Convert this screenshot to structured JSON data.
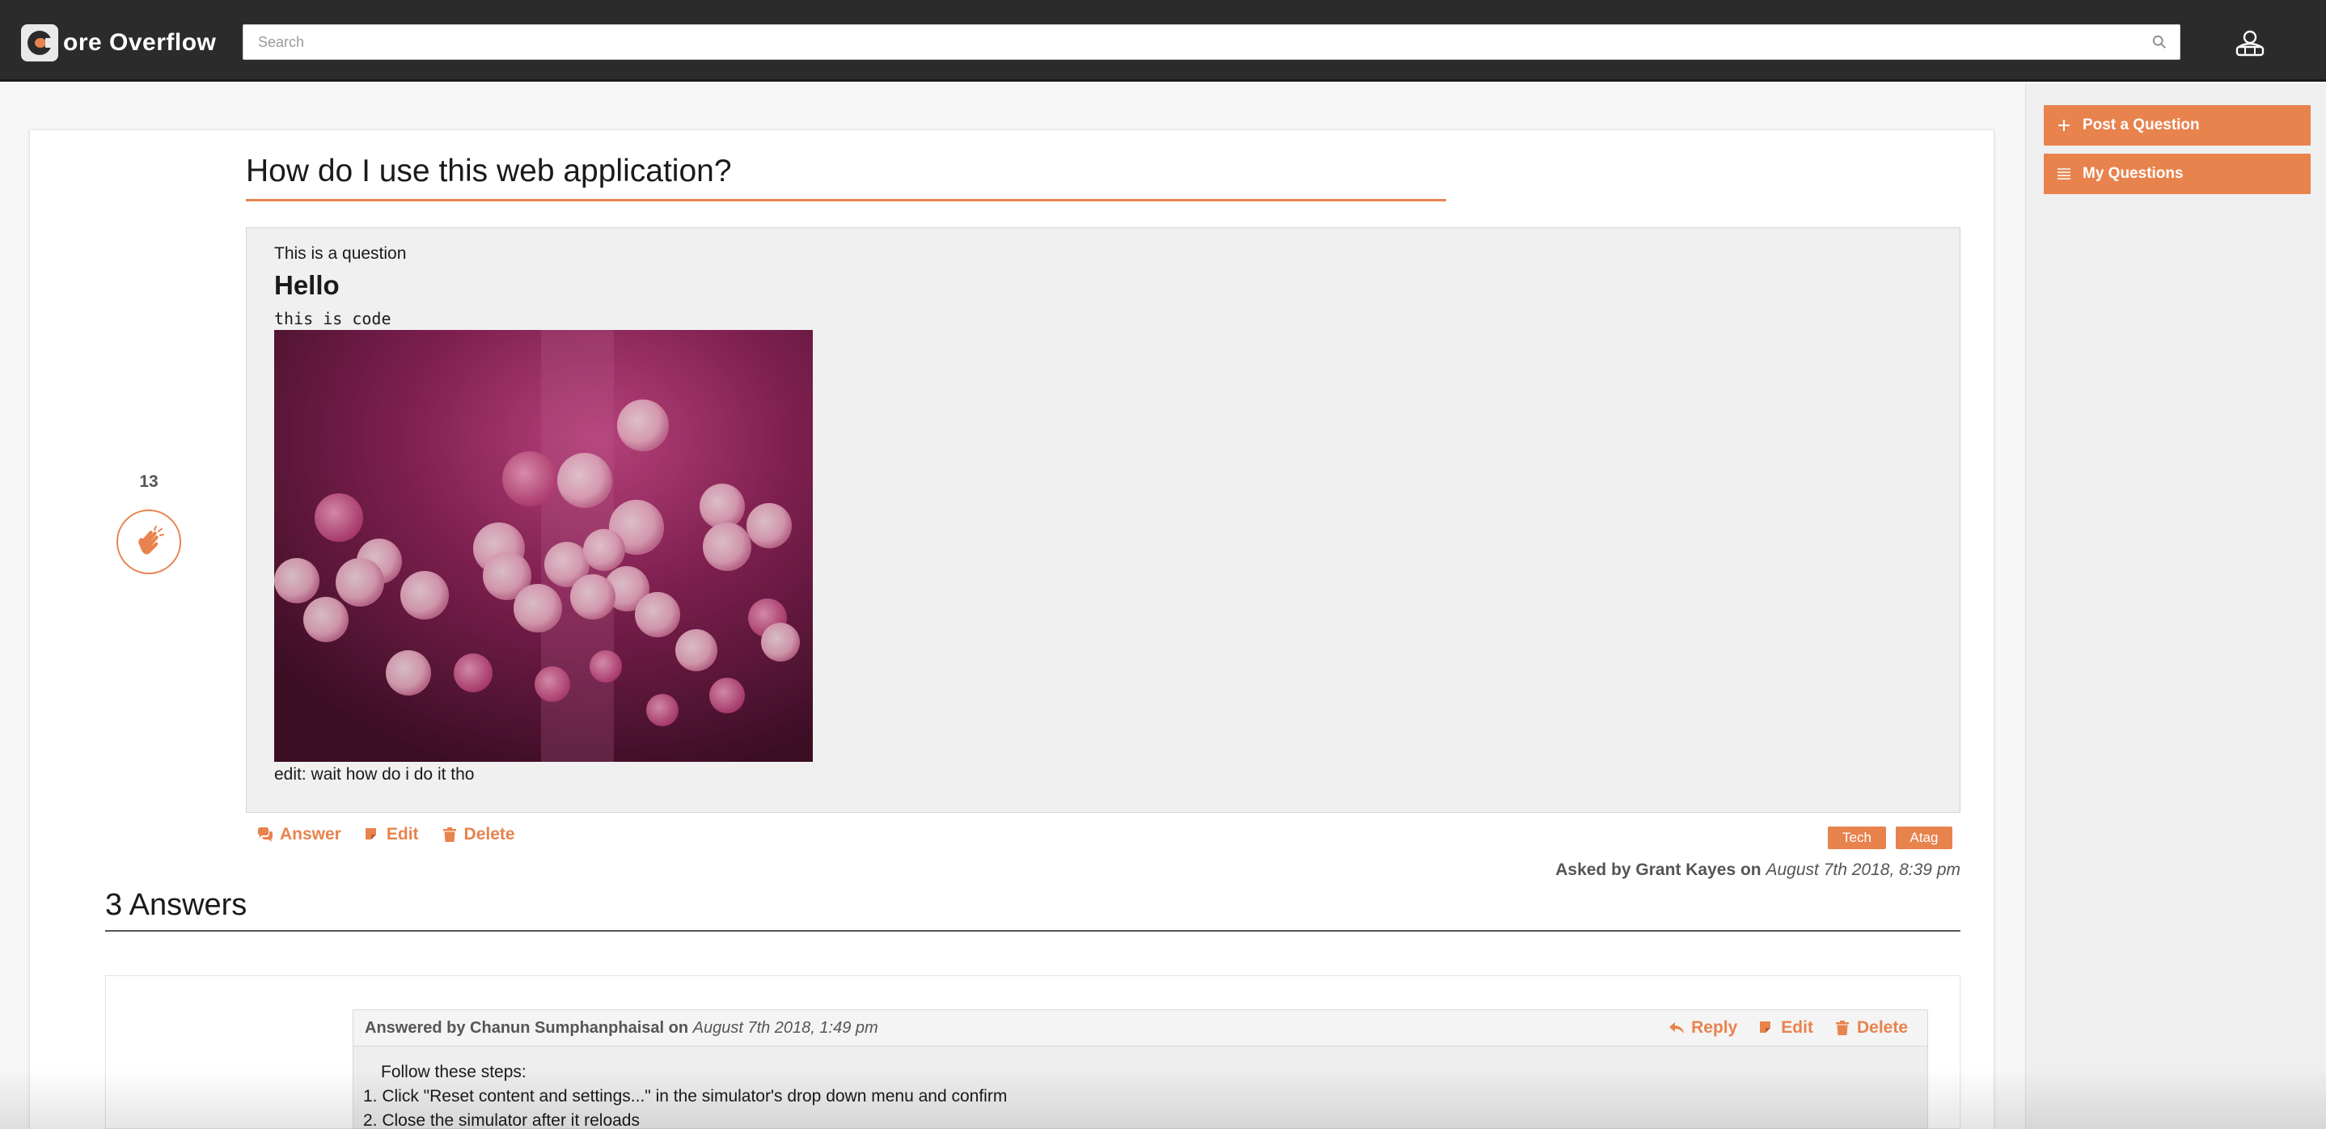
{
  "header": {
    "logo_text": "ore Overflow",
    "search_placeholder": "Search",
    "search_value": ""
  },
  "sidebar": {
    "post_question_label": "Post a Question",
    "my_questions_label": "My Questions"
  },
  "question": {
    "title": "How do I use this web application?",
    "vote_count": "13",
    "body_line": "This is a question",
    "body_heading": "Hello",
    "body_code": "this is code",
    "body_edit": "edit: wait how do i do it tho",
    "actions": {
      "answer": "Answer",
      "edit": "Edit",
      "delete": "Delete"
    },
    "tags": [
      "Tech",
      "Atag"
    ],
    "asked_prefix": "Asked by Grant Kayes on",
    "asked_date": "August 7th 2018, 8:39 pm"
  },
  "answers": {
    "heading": "3 Answers",
    "items": [
      {
        "author_prefix": "Answered by Chanun Sumphanphaisal on",
        "date": "August 7th 2018, 1:49 pm",
        "actions": {
          "reply": "Reply",
          "edit": "Edit",
          "delete": "Delete"
        },
        "lines": [
          "Follow these steps:",
          "1. Click \"Reset content and settings...\" in the simulator's drop down menu and confirm",
          "2. Close the simulator after it reloads"
        ]
      }
    ]
  },
  "colors": {
    "accent": "#e8834e",
    "topbar": "#2b2b2b"
  },
  "icons": {
    "search": "search-icon",
    "user": "user-icon",
    "plus": "plus-icon",
    "list": "list-icon",
    "clap": "clap-icon",
    "comments": "comments-icon",
    "edit": "edit-icon",
    "trash": "trash-icon",
    "reply": "reply-icon"
  }
}
